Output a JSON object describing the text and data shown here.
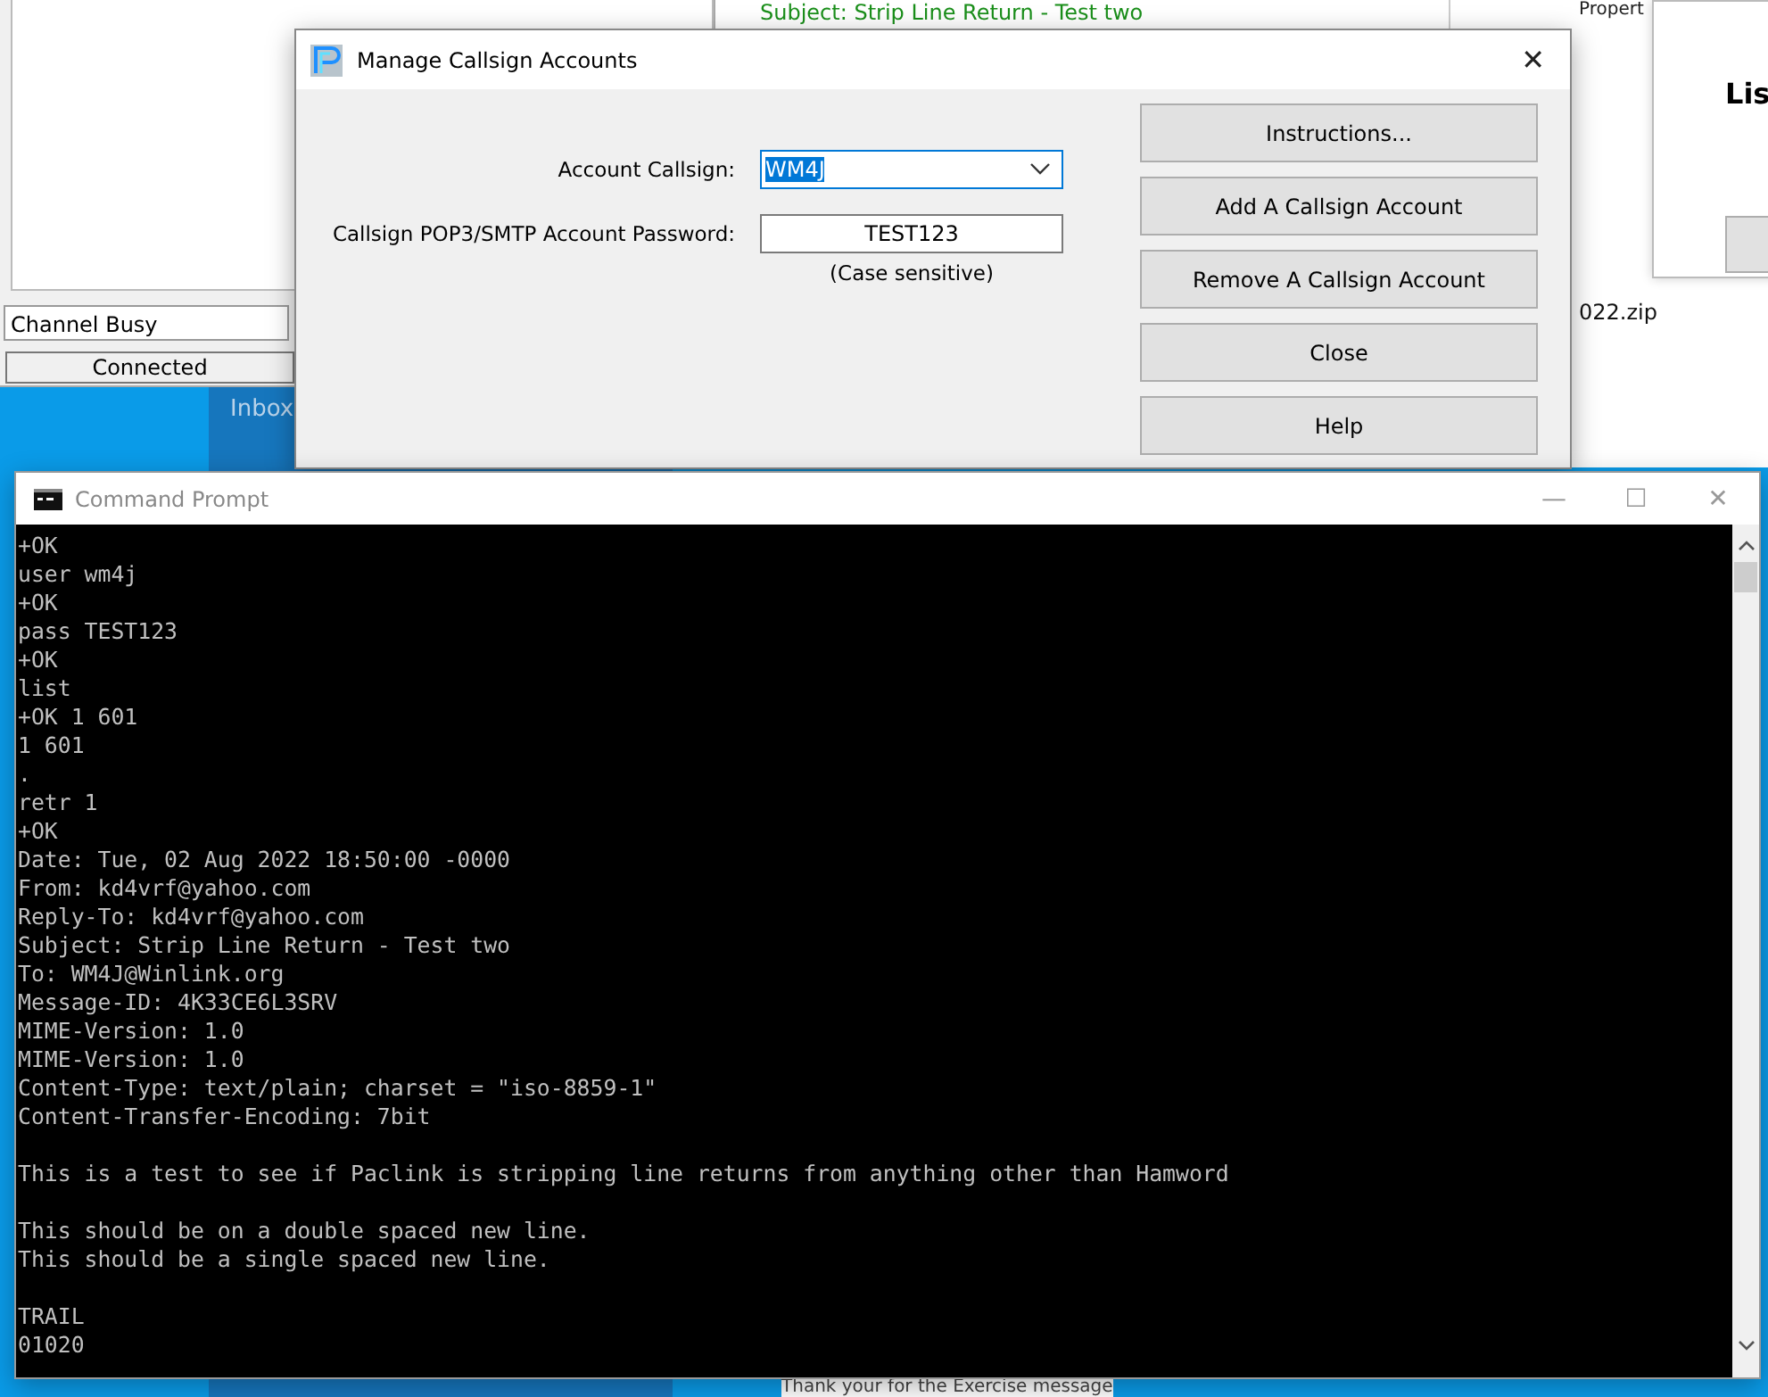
{
  "background_app": {
    "status": "Channel Busy",
    "connection": "Connected",
    "folder": "Inbox"
  },
  "message_window": {
    "subject": "Subject: Strip Line Return - Test two",
    "ribbon_label": "Propert",
    "attachment": "022.zip",
    "preview": "Thank your for the Exercise message"
  },
  "list_dialog": {
    "title": "Lis"
  },
  "dialog": {
    "title": "Manage Callsign Accounts",
    "close": "✕",
    "fields": [
      {
        "kind": "combo",
        "label": "Account Callsign:",
        "value": "WM4J",
        "selected": true
      },
      {
        "kind": "text",
        "label": "Callsign POP3/SMTP Account Password:",
        "value": "TEST123",
        "selected": false,
        "note": "(Case sensitive)"
      }
    ],
    "buttons": [
      "Instructions...",
      "Add A Callsign Account",
      "Remove A Callsign Account",
      "Close",
      "Help"
    ]
  },
  "console": {
    "title": "Command Prompt",
    "controls": [
      "—",
      "☐",
      "✕"
    ],
    "blocks": [
      [
        "+OK",
        "user wm4j",
        "+OK",
        "pass TEST123",
        "+OK",
        "list",
        "+OK 1 601",
        "1 601",
        ".",
        "retr 1",
        "+OK",
        "Date: Tue, 02 Aug 2022 18:50:00 -0000",
        "From: kd4vrf@yahoo.com",
        "Reply-To: kd4vrf@yahoo.com",
        "Subject: Strip Line Return - Test two",
        "To: WM4J@Winlink.org",
        "Message-ID: 4K33CE6L3SRV",
        "MIME-Version: 1.0",
        "MIME-Version: 1.0",
        "Content-Type: text/plain; charset = \"iso-8859-1\"",
        "Content-Transfer-Encoding: 7bit"
      ],
      [
        "This is a test to see if Paclink is stripping line returns from anything other than Hamword"
      ],
      [
        "This should be on a double spaced new line.",
        "This should be a single spaced new line."
      ],
      [
        "TRAIL",
        "01020"
      ]
    ]
  }
}
